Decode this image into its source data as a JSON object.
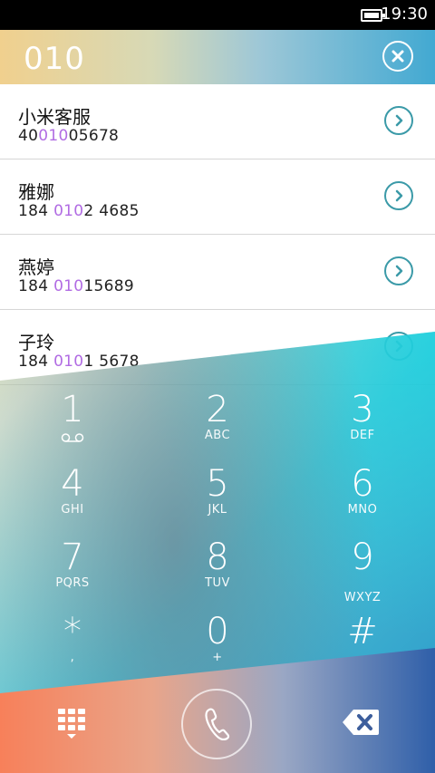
{
  "status_bar": {
    "time": "19:30"
  },
  "dial": {
    "number": "010"
  },
  "contacts": [
    {
      "name": "小米客服",
      "phone_pre": "40",
      "phone_hl": "010",
      "phone_post": "05678"
    },
    {
      "name": "雅娜",
      "phone_pre": "184 ",
      "phone_hl": "010",
      "phone_post": "2 4685"
    },
    {
      "name": "燕婷",
      "phone_pre": "184 ",
      "phone_hl": "010",
      "phone_post": "15689"
    },
    {
      "name": "子玲",
      "phone_pre": "184 ",
      "phone_hl": "010",
      "phone_post": "1 5678"
    }
  ],
  "keys": [
    {
      "digit": "1",
      "letters": ""
    },
    {
      "digit": "2",
      "letters": "ABC"
    },
    {
      "digit": "3",
      "letters": "DEF"
    },
    {
      "digit": "4",
      "letters": "GHI"
    },
    {
      "digit": "5",
      "letters": "JKL"
    },
    {
      "digit": "6",
      "letters": "MNO"
    },
    {
      "digit": "7",
      "letters": "PQRS"
    },
    {
      "digit": "8",
      "letters": "TUV"
    },
    {
      "digit": "9",
      "letters": "WXYZ"
    },
    {
      "digit": "*",
      "letters": ","
    },
    {
      "digit": "0",
      "letters": "+"
    },
    {
      "digit": "#",
      "letters": ""
    }
  ],
  "icons": {
    "clear": "close-icon",
    "row_action": "chevron-right-icon",
    "voicemail": "voicemail-icon",
    "dialpad": "dialpad-icon",
    "call": "phone-icon",
    "backspace": "backspace-icon"
  },
  "colors": {
    "highlight": "#b16ce3",
    "row_action": "#3b9aa8"
  }
}
